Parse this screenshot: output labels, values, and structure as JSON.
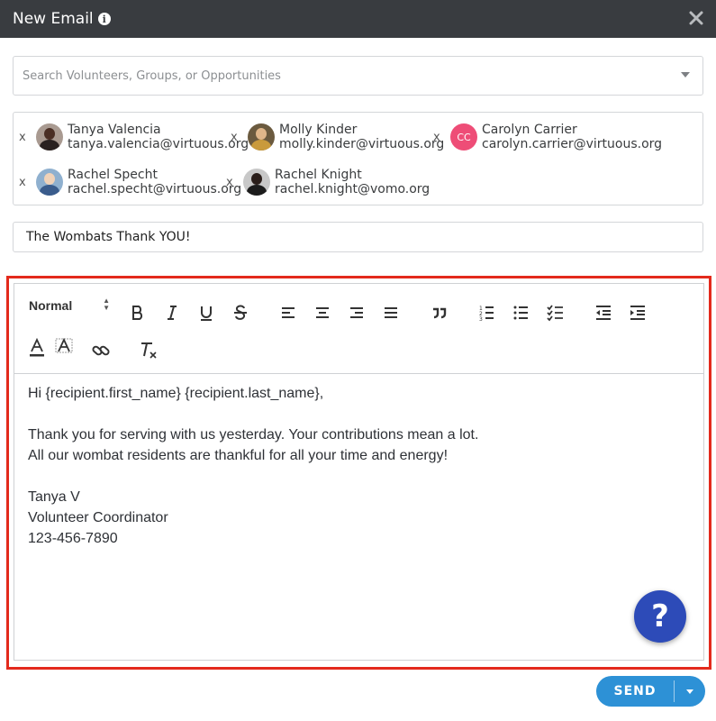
{
  "window": {
    "title": "New Email",
    "info_icon": "info-icon",
    "close_icon": "close-icon"
  },
  "search": {
    "placeholder": "Search Volunteers, Groups, or Opportunities",
    "value": ""
  },
  "recipients": [
    {
      "remove": "x",
      "name": "Tanya Valencia",
      "email": "tanya.valencia@virtuous.org",
      "avatar": "photo"
    },
    {
      "remove": "x",
      "name": "Molly Kinder",
      "email": "molly.kinder@virtuous.org",
      "avatar": "photo"
    },
    {
      "remove": "x",
      "name": "Carolyn Carrier",
      "email": "carolyn.carrier@virtuous.org",
      "avatar": "initials",
      "initials": "CC",
      "avatar_color": "#ee4d77"
    },
    {
      "remove": "x",
      "name": "Rachel Specht",
      "email": "rachel.specht@virtuous.org",
      "avatar": "photo"
    },
    {
      "remove": "x",
      "name": "Rachel Knight",
      "email": "rachel.knight@vomo.org",
      "avatar": "photo"
    }
  ],
  "subject": {
    "value": "The Wombats Thank YOU!"
  },
  "toolbar": {
    "format_select": "Normal",
    "buttons": [
      "bold",
      "italic",
      "underline",
      "strike",
      "align-left",
      "align-center",
      "align-right",
      "align-justify",
      "blockquote",
      "ordered-list",
      "bullet-list",
      "check-list",
      "outdent",
      "indent",
      "text-color",
      "background-color",
      "link",
      "clear-format"
    ]
  },
  "body": {
    "lines": [
      "Hi {recipient.first_name} {recipient.last_name},",
      "",
      "Thank you for serving with us yesterday. Your contributions mean a lot.",
      "All our wombat residents are thankful for all your time and energy!",
      "",
      "Tanya V",
      "Volunteer Coordinator",
      "123-456-7890"
    ]
  },
  "help": {
    "label": "?"
  },
  "send": {
    "label": "SEND"
  },
  "colors": {
    "titlebar": "#393c40",
    "accent": "#2d91d6",
    "highlight": "#e32a1c",
    "help": "#2d4bb8"
  }
}
